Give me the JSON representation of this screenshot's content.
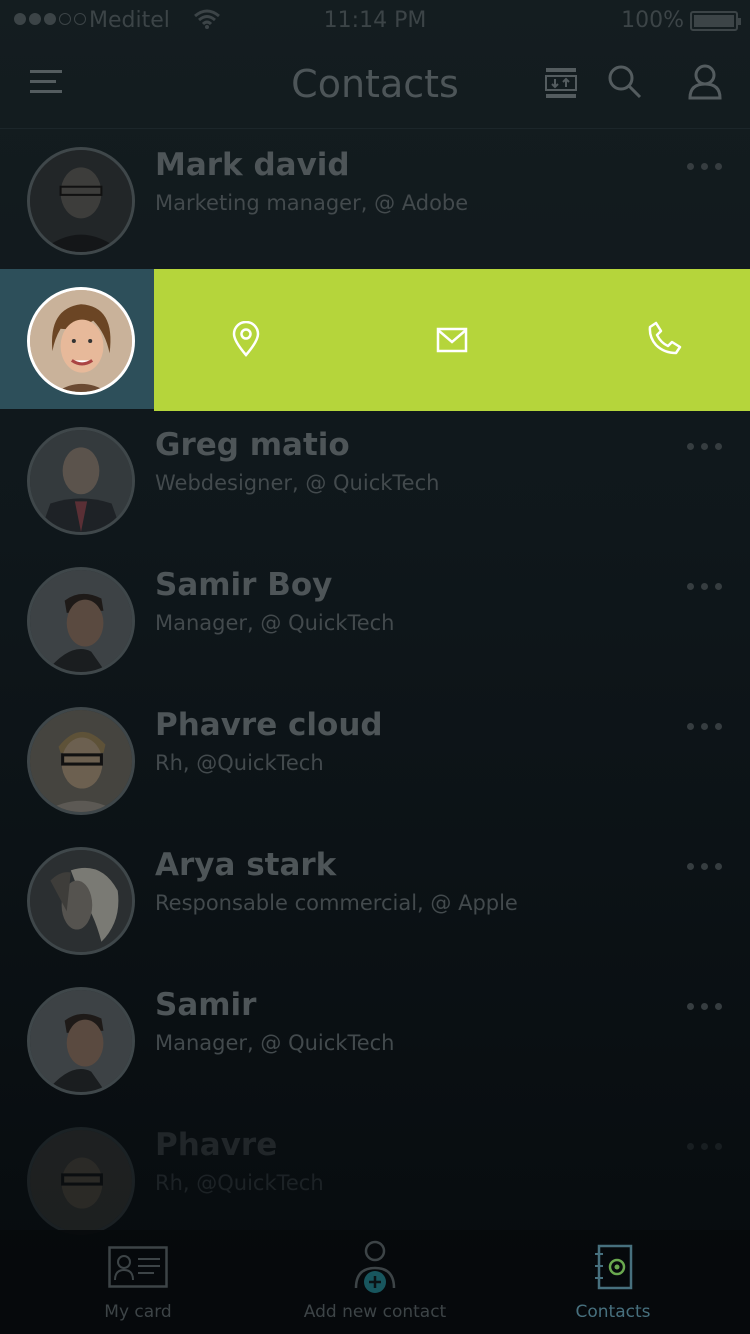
{
  "status_bar": {
    "carrier": "Meditel",
    "time": "11:14 PM",
    "battery": "100%"
  },
  "header": {
    "title": "Contacts"
  },
  "contacts": [
    {
      "name": "Mark david",
      "subtitle": "Marketing manager, @ Adobe"
    },
    {
      "name": "",
      "subtitle": ""
    },
    {
      "name": "Greg matio",
      "subtitle": "Webdesigner, @ QuickTech"
    },
    {
      "name": "Samir Boy",
      "subtitle": "Manager, @ QuickTech"
    },
    {
      "name": "Phavre cloud",
      "subtitle": "Rh, @QuickTech"
    },
    {
      "name": "Arya stark",
      "subtitle": "Responsable commercial, @ Apple"
    },
    {
      "name": "Samir",
      "subtitle": "Manager, @ QuickTech"
    },
    {
      "name": "Phavre",
      "subtitle": "Rh, @QuickTech"
    }
  ],
  "swipe_actions": [
    "location-icon",
    "mail-icon",
    "phone-icon"
  ],
  "tabbar": {
    "my_card": "My card",
    "add_contact": "Add  new contact",
    "contacts": "Contacts"
  },
  "colors": {
    "accent": "#b5d53b",
    "active_row": "#2d4f5a",
    "selected_tab": "#47707e"
  }
}
